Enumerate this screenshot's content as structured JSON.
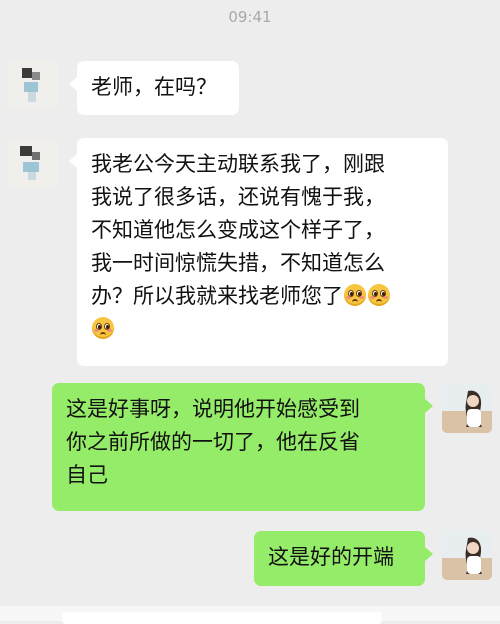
{
  "status_bar": {
    "time": "09:41"
  },
  "conversation": {
    "messages": [
      {
        "side": "left",
        "text": "老师，在吗？"
      },
      {
        "side": "left",
        "lines": [
          "我老公今天主动联系我了，刚跟",
          "我说了很多话，还说有愧于我，",
          "不知道他怎么变成这个样子了，",
          "我一时间惊慌失措，不知道怎么",
          "办？所以我就来找老师您了"
        ],
        "emoji": "pleading-face"
      },
      {
        "side": "right",
        "lines": [
          "这是好事呀，说明他开始感受到",
          "你之前所做的一切了，他在反省",
          "自己"
        ]
      },
      {
        "side": "right",
        "text": "这是好的开端"
      }
    ]
  },
  "colors": {
    "background": "#ededed",
    "incoming_bubble": "#ffffff",
    "outgoing_bubble": "#95ec69"
  }
}
